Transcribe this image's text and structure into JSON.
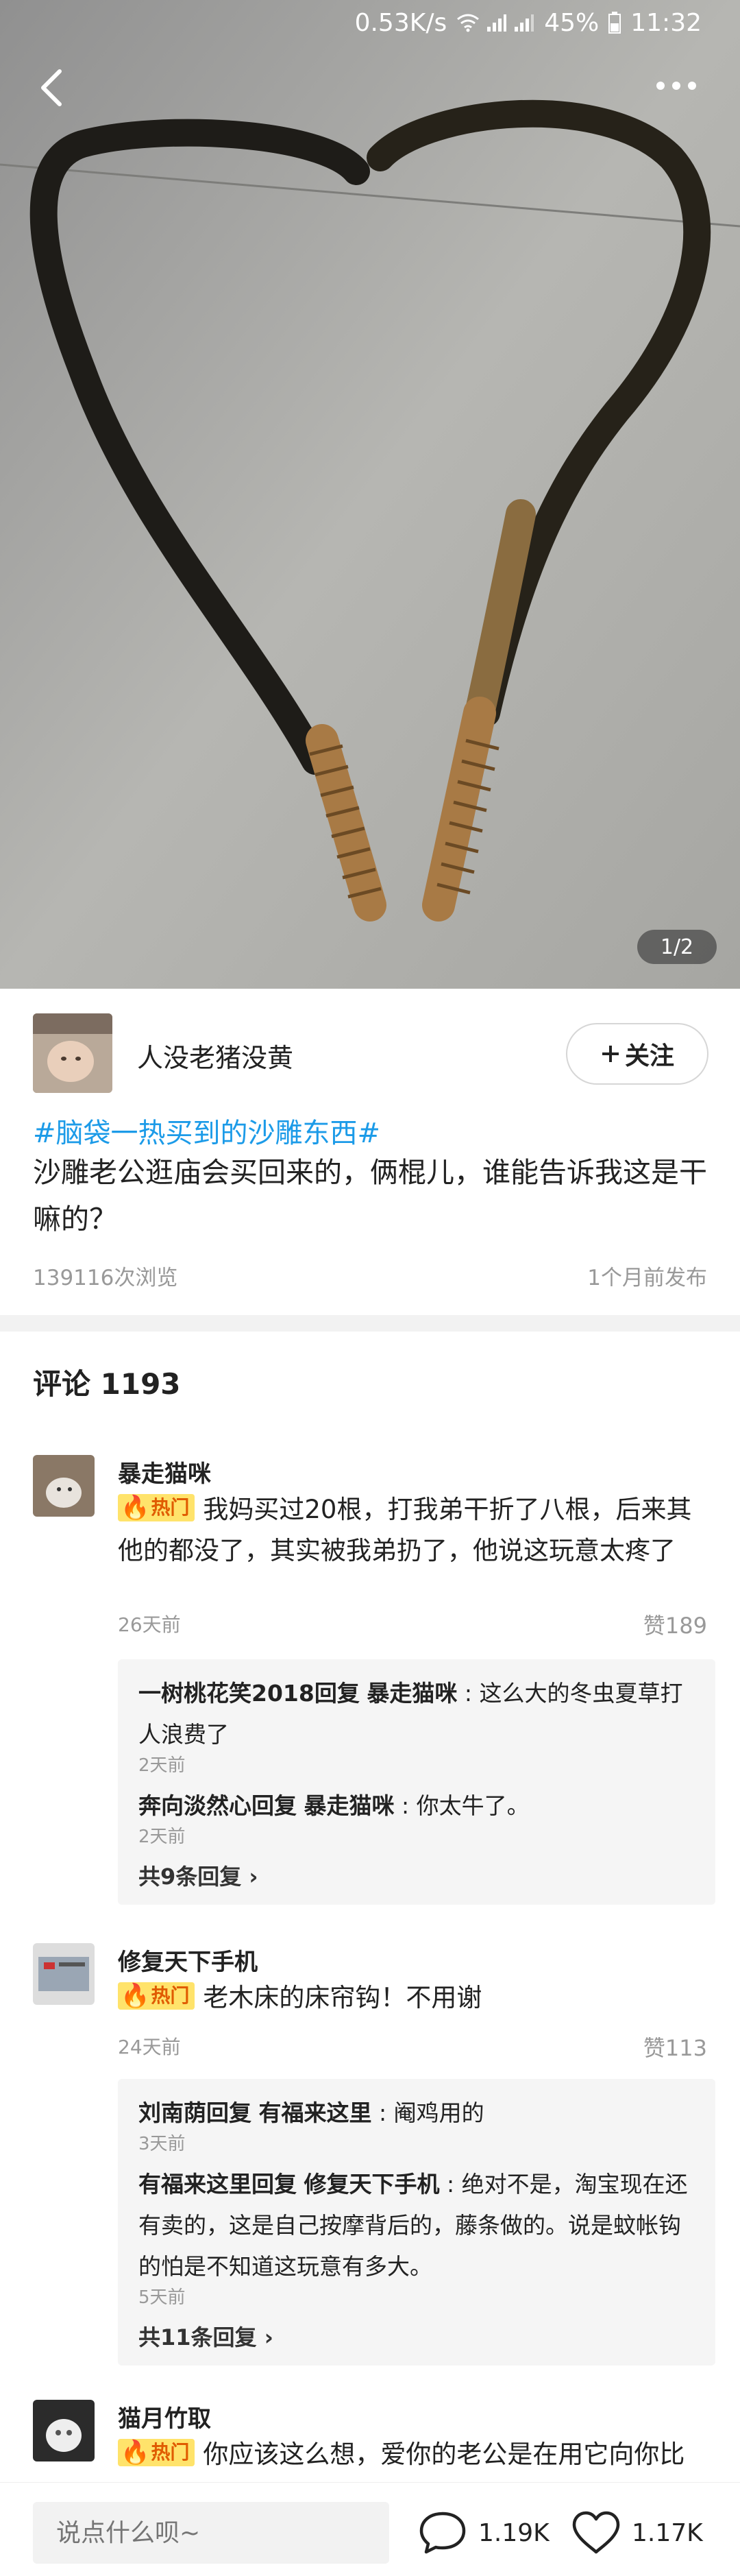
{
  "status_bar": {
    "network_speed": "0.53K/s",
    "battery": "45%",
    "time": "11:32"
  },
  "gallery": {
    "page_counter": "1/2"
  },
  "post": {
    "author": "人没老猪没黄",
    "follow_label": "关注",
    "topic_tag": "#脑袋一热买到的沙雕东西#",
    "text": "沙雕老公逛庙会买回来的，俩棍儿，谁能告诉我这是干嘛的？",
    "views": "139116次浏览",
    "published": "1个月前发布"
  },
  "comments_header": "评论 1193",
  "hot_label": "热门",
  "comments": [
    {
      "user": "暴走猫咪",
      "text": "我妈买过20根，打我弟干折了八根，后来其他的都没了，其实被我弟扔了，他说这玩意太疼了",
      "time": "26天前",
      "likes": "赞189",
      "replies": [
        {
          "author": "一树桃花笑2018",
          "verb": "回复",
          "target": "暴走猫咪",
          "text": "这么大的冬虫夏草打人浪费了",
          "time": "2天前"
        },
        {
          "author": "奔向淡然心",
          "verb": "回复",
          "target": "暴走猫咪",
          "text": "你太牛了。",
          "time": "2天前"
        }
      ],
      "more": "共9条回复"
    },
    {
      "user": "修复天下手机",
      "text": "老木床的床帘钩！不用谢",
      "time": "24天前",
      "likes": "赞113",
      "replies": [
        {
          "author": "刘南荫",
          "verb": "回复",
          "target": "有福来这里",
          "text": "阉鸡用的",
          "time": "3天前"
        },
        {
          "author": "有福来这里",
          "verb": "回复",
          "target": "修复天下手机",
          "text": "绝对不是，淘宝现在还有卖的，这是自己按摩背后的，藤条做的。说是蚊帐钩的怕是不知道这玩意有多大。",
          "time": "5天前"
        }
      ],
      "more": "共11条回复"
    },
    {
      "user": "猫月竹取",
      "text": "你应该这么想，爱你的老公是在用它向你比心"
    }
  ],
  "bottom_bar": {
    "input_placeholder": "说点什么呗~",
    "comment_count": "1.19K",
    "like_count": "1.17K"
  },
  "icons": {
    "back": "chevron-left-icon",
    "more": "more-dots-icon",
    "follow": "plus-icon",
    "comment": "speech-bubble-icon",
    "like": "heart-icon",
    "hot": "flame-icon"
  }
}
